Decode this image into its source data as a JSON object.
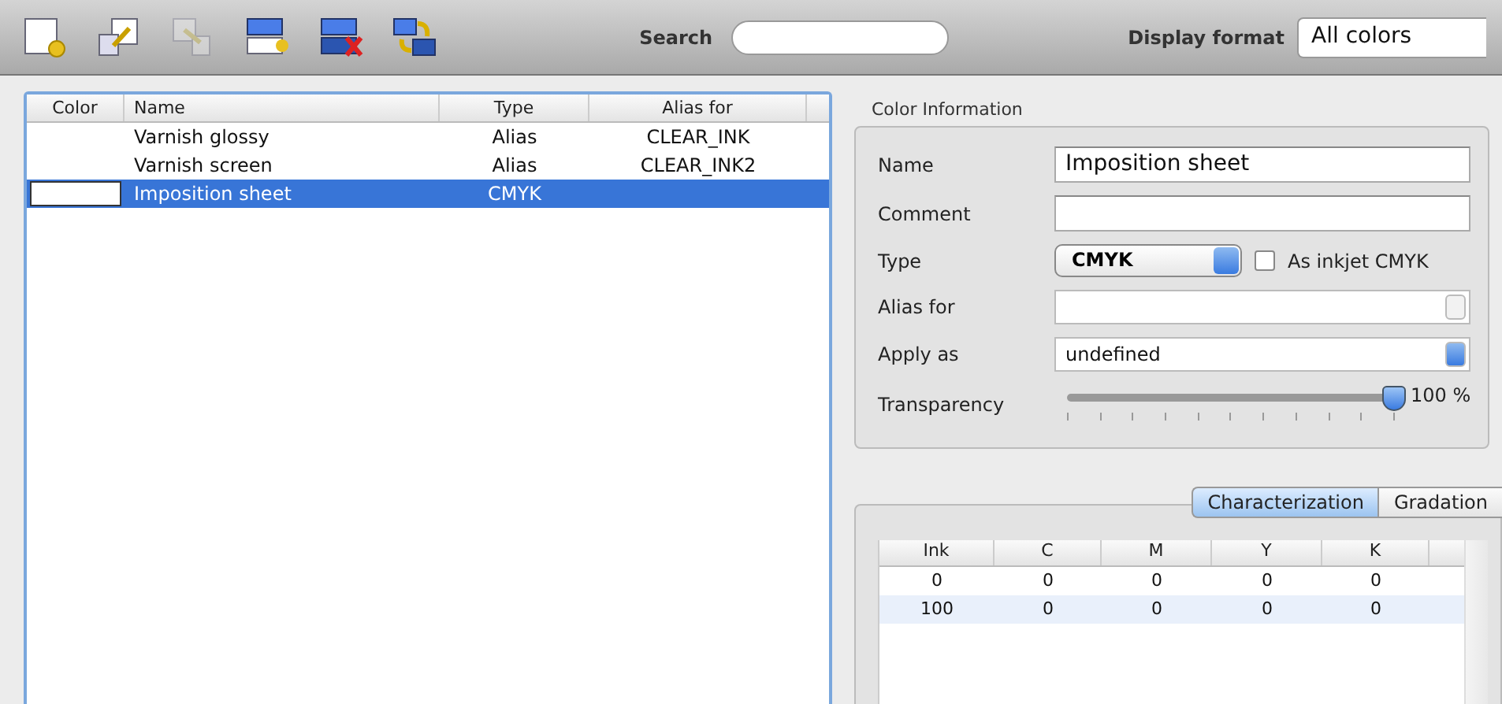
{
  "toolbar": {
    "buttons": [
      {
        "kind": "new",
        "disabled": false
      },
      {
        "kind": "duplicate",
        "disabled": false
      },
      {
        "kind": "copy",
        "disabled": true
      },
      {
        "kind": "insert",
        "disabled": false
      },
      {
        "kind": "delete",
        "disabled": false
      },
      {
        "kind": "swap",
        "disabled": false
      }
    ],
    "search_label": "Search",
    "display_format_label": "Display format",
    "display_format": "All colors"
  },
  "color_list": {
    "columns": [
      "Color",
      "Name",
      "Type",
      "Alias for"
    ],
    "rows": [
      {
        "name": "Varnish glossy",
        "type": "Alias",
        "alias_for": "CLEAR_INK",
        "selected": false
      },
      {
        "name": "Varnish screen",
        "type": "Alias",
        "alias_for": "CLEAR_INK2",
        "selected": false
      },
      {
        "name": "Imposition sheet",
        "type": "CMYK",
        "color": "#ffffff",
        "selected": true
      }
    ]
  },
  "color_information": {
    "title": "Color Information",
    "name_label": "Name",
    "name": "Imposition sheet",
    "comment_label": "Comment",
    "type_label": "Type",
    "type": "CMYK",
    "inkjet_label": "As inkjet CMYK",
    "inkjet_checked": false,
    "alias_label": "Alias for",
    "apply_label": "Apply as",
    "apply_as": "undefined",
    "transparency_label": "Transparency",
    "transparency": {
      "level": 1,
      "reading": "100 %"
    }
  },
  "tabs": [
    {
      "label": "Characterization",
      "selected": true
    },
    {
      "label": "Gradation",
      "selected": false
    }
  ],
  "ink_table": {
    "columns": [
      "Ink",
      "C",
      "M",
      "Y",
      "K"
    ],
    "rows": [
      [
        "0",
        "0",
        "0",
        "0",
        "0"
      ],
      [
        "100",
        "0",
        "0",
        "0",
        "0"
      ]
    ]
  }
}
